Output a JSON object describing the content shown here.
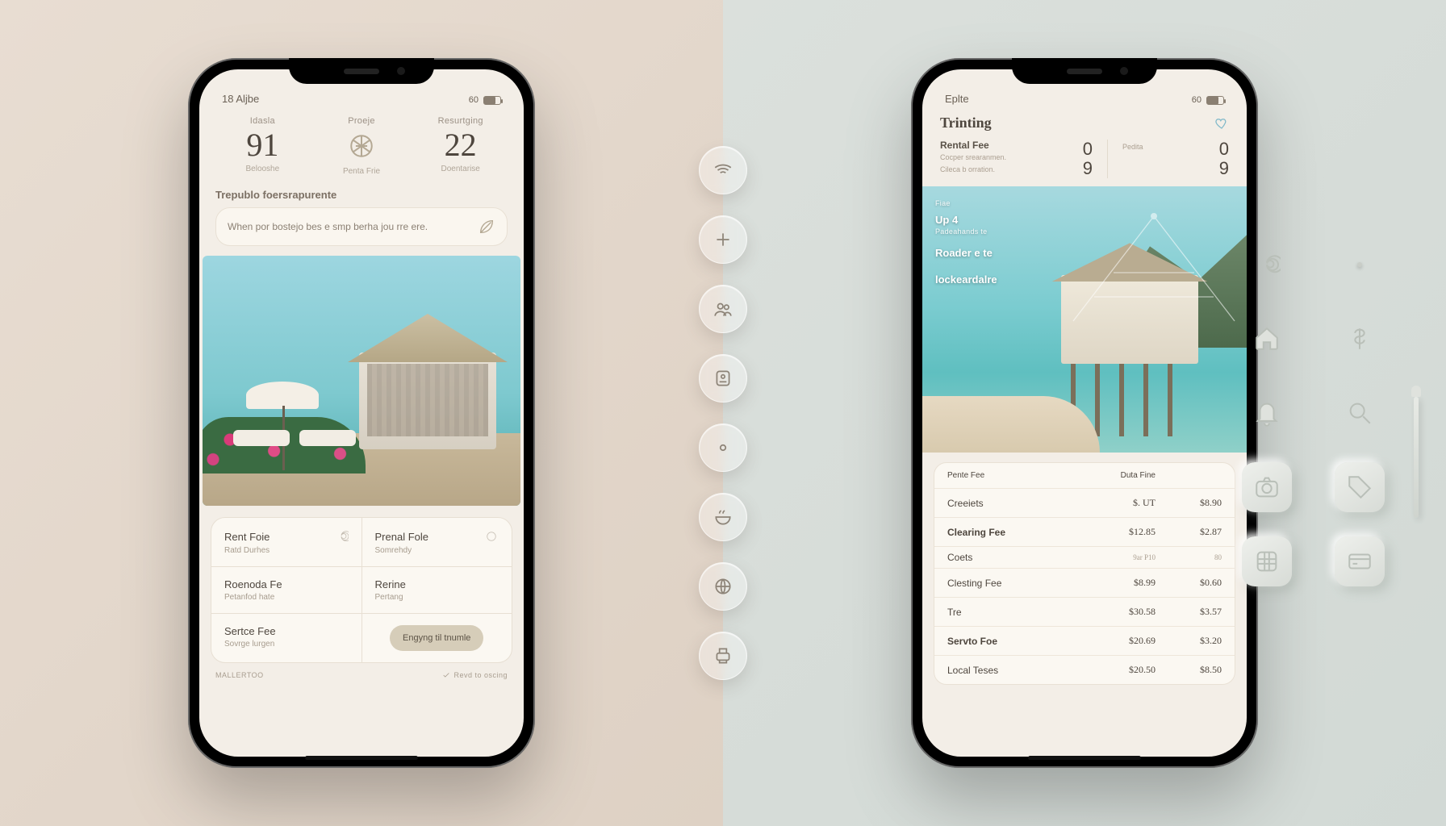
{
  "phone1": {
    "status_left": "18 Aljbe",
    "status_right": "60",
    "metrics": [
      {
        "lbl": "Idasla",
        "val": "91",
        "sub": "Belooshe"
      },
      {
        "lbl": "Proeje",
        "val": "",
        "sub": "Penta Frie"
      },
      {
        "lbl": "Resurtging",
        "val": "22",
        "sub": "Doentarise"
      }
    ],
    "banner_title": "Trepublo foersrapurente",
    "tip_text": "When por bostejo bes e smp berha jou rre ere.",
    "grid": [
      [
        {
          "a": "Rent Foie",
          "b": "Ratd Durhes"
        },
        {
          "a": "Prenal Fole",
          "b": "Somrehdy"
        }
      ],
      [
        {
          "a": "Roenoda Fe",
          "b": "Petanfod hate"
        },
        {
          "a": "Rerine",
          "b": "Pertang"
        }
      ],
      [
        {
          "a": "Sertce Fee",
          "b": "Sovrge lurgen"
        },
        {
          "pill": "Engyng til tnumle"
        }
      ]
    ],
    "foot_left": "MALLERTOO",
    "foot_right": "Revd to oscing"
  },
  "phone2": {
    "status_left": "Eplte",
    "status_right": "60",
    "title": "Trinting",
    "summary": {
      "line1": "Rental Fee",
      "desc1": "Cocper srearanmen.",
      "desc2": "Cileca b orration.",
      "n1": "0",
      "n2": "9",
      "l1": "Pedita",
      "l2": "0",
      "l3": "9"
    },
    "overlay": {
      "a": "Fiae",
      "b": "Up 4",
      "c": "Padeahands te",
      "d": "Roader e te",
      "e": "lockeardalre"
    },
    "headers": {
      "c1": "Pente Fee",
      "c2": "Duta Fine",
      "c3": ""
    },
    "rows": [
      {
        "c1": "Creeiets",
        "c2": "$. UT",
        "c3": "$8.90"
      },
      {
        "c1": "Clearing Fee",
        "c2": "$12.85",
        "c3": "$2.87",
        "bold": true
      },
      {
        "c1": "Coets",
        "sub": "",
        "c2": "9ar P10",
        "c3": "80"
      },
      {
        "c1": "Clesting Fee",
        "c2": "$8.99",
        "c3": "$0.60"
      },
      {
        "c1": "Tre",
        "c2": "$30.58",
        "c3": "$3.57"
      },
      {
        "c1": "Servto Foe",
        "c2": "$20.69",
        "c3": "$3.20",
        "bold": true
      },
      {
        "c1": "Local Teses",
        "c2": "$20.50",
        "c3": "$8.50"
      }
    ]
  },
  "rail": [
    "wifi",
    "plus",
    "users",
    "badge",
    "dot",
    "bowl",
    "globe",
    "printer"
  ],
  "tray": [
    "spiral",
    "pin",
    "home",
    "dollar",
    "bell",
    "search",
    "camera",
    "tag",
    "grid",
    "card"
  ]
}
